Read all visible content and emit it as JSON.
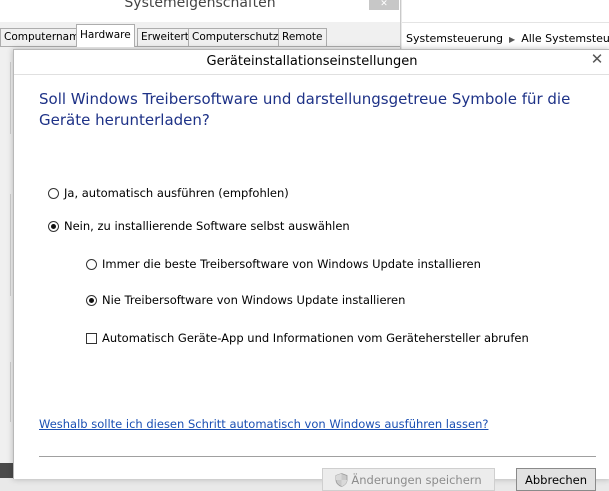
{
  "background_window": {
    "title": "Systemeigenschaften",
    "close_label": "✕",
    "tabs": [
      {
        "label": "Computername",
        "active": false
      },
      {
        "label": "Hardware",
        "active": true
      },
      {
        "label": "Erweitert",
        "active": false
      },
      {
        "label": "Computerschutz",
        "active": false
      },
      {
        "label": "Remote",
        "active": false
      }
    ]
  },
  "control_panel": {
    "breadcrumb": [
      "Systemsteuerung",
      "Alle Systemsteuerungselemente"
    ],
    "separator": "▶"
  },
  "dialog": {
    "title": "Geräteinstallationseinstellungen",
    "close_label": "✕",
    "question": "Soll Windows Treibersoftware und darstellungsgetreue Symbole für die Geräte herunterladen?",
    "options": {
      "auto": {
        "label": "Ja, automatisch ausführen (empfohlen)",
        "selected": false
      },
      "manual": {
        "label": "Nein, zu installierende Software selbst auswählen",
        "selected": true
      },
      "best_driver": {
        "label": "Immer die beste Treibersoftware von Windows Update installieren",
        "selected": false
      },
      "never_driver": {
        "label": "Nie Treibersoftware von Windows Update installieren",
        "selected": true
      },
      "device_app": {
        "label": "Automatisch Geräte-App und Informationen vom Gerätehersteller abrufen",
        "checked": false
      }
    },
    "help_link": "Weshalb sollte ich diesen Schritt automatisch von Windows ausführen lassen?",
    "save_button": "Änderungen speichern",
    "cancel_button": "Abbrechen"
  },
  "colors": {
    "heading": "#1e3287",
    "link": "#1a4fb3"
  }
}
